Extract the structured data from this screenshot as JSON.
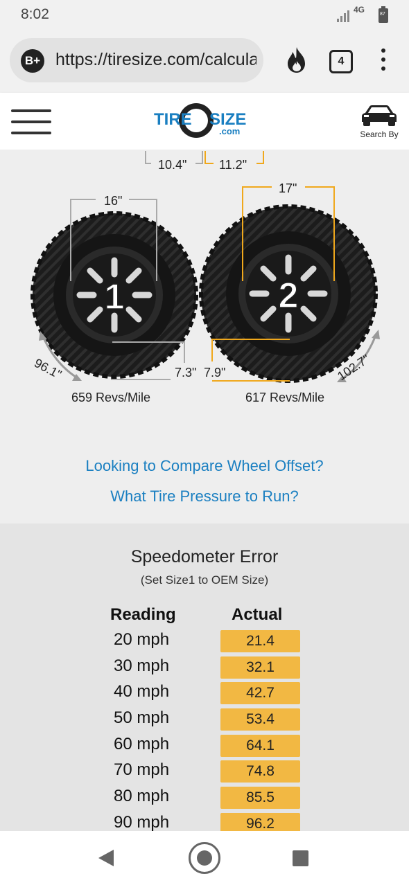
{
  "status_bar": {
    "time": "8:02",
    "network": "4G",
    "battery": "87"
  },
  "browser": {
    "security_badge": "B+",
    "url": "https://tiresize.com/calculator/",
    "tab_count": "4",
    "icons": [
      "flame-icon",
      "tabs-icon",
      "more-options-icon"
    ]
  },
  "site_header": {
    "logo_text_a": "TIRE",
    "logo_text_b": "SIZE",
    "logo_text_c": ".com",
    "search_by_label": "Search By",
    "icons": [
      "hamburger-menu-icon",
      "car-icon"
    ]
  },
  "comparison": {
    "top_dims": [
      "10.4\"",
      "11.2\""
    ],
    "tire1": {
      "number": "1",
      "rim": "16\"",
      "sidewall": "7.3\"",
      "circumference": "96.1\"",
      "revs": "659 Revs/Mile"
    },
    "tire2": {
      "number": "2",
      "rim": "17\"",
      "sidewall": "7.9\"",
      "circumference": "102.7\"",
      "revs": "617 Revs/Mile"
    }
  },
  "links": {
    "offset": "Looking to Compare Wheel Offset?",
    "pressure": "What Tire Pressure to Run?"
  },
  "speedometer": {
    "title": "Speedometer Error",
    "subtitle": "(Set Size1 to OEM Size)",
    "headers": {
      "reading": "Reading",
      "actual": "Actual"
    },
    "rows": [
      {
        "reading": "20 mph",
        "actual": "21.4"
      },
      {
        "reading": "30 mph",
        "actual": "32.1"
      },
      {
        "reading": "40 mph",
        "actual": "42.7"
      },
      {
        "reading": "50 mph",
        "actual": "53.4"
      },
      {
        "reading": "60 mph",
        "actual": "64.1"
      },
      {
        "reading": "70 mph",
        "actual": "74.8"
      },
      {
        "reading": "80 mph",
        "actual": "85.5"
      },
      {
        "reading": "90 mph",
        "actual": "96.2"
      }
    ]
  },
  "colors": {
    "accent_orange": "#f2b843",
    "link_blue": "#1a7fc1",
    "logo_blue": "#1a7fc1",
    "size2_line": "#f0a81c",
    "size1_line": "#aaaaaa"
  }
}
